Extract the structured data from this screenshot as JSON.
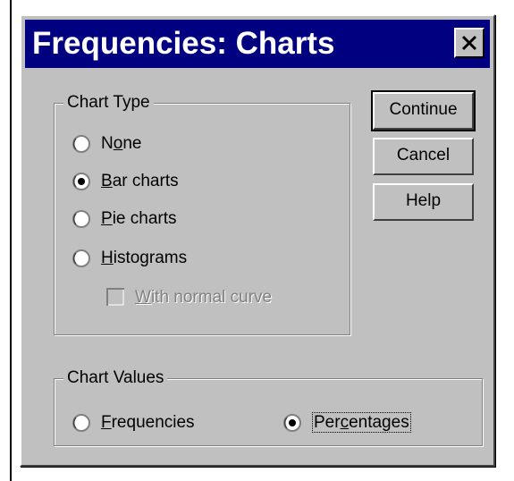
{
  "window": {
    "title": "Frequencies: Charts"
  },
  "chart_type": {
    "legend": "Chart Type",
    "options": [
      {
        "pre": "N",
        "key": "o",
        "post": "ne",
        "selected": false
      },
      {
        "pre": "",
        "key": "B",
        "post": "ar charts",
        "selected": true
      },
      {
        "pre": "",
        "key": "P",
        "post": "ie charts",
        "selected": false
      },
      {
        "pre": "",
        "key": "H",
        "post": "istograms",
        "selected": false
      }
    ],
    "normal_curve": {
      "pre": "",
      "key": "W",
      "post": "ith normal curve",
      "checked": false,
      "enabled": false
    }
  },
  "chart_values": {
    "legend": "Chart Values",
    "frequencies": {
      "pre": "",
      "key": "F",
      "post": "requencies",
      "selected": false
    },
    "percentages": {
      "pre": "Per",
      "key": "c",
      "post": "entages",
      "selected": true
    }
  },
  "buttons": {
    "continue": "Continue",
    "cancel": "Cancel",
    "help": "Help"
  },
  "colors": {
    "title_bar": "#000080",
    "dialog_face": "#c0c0c0"
  }
}
